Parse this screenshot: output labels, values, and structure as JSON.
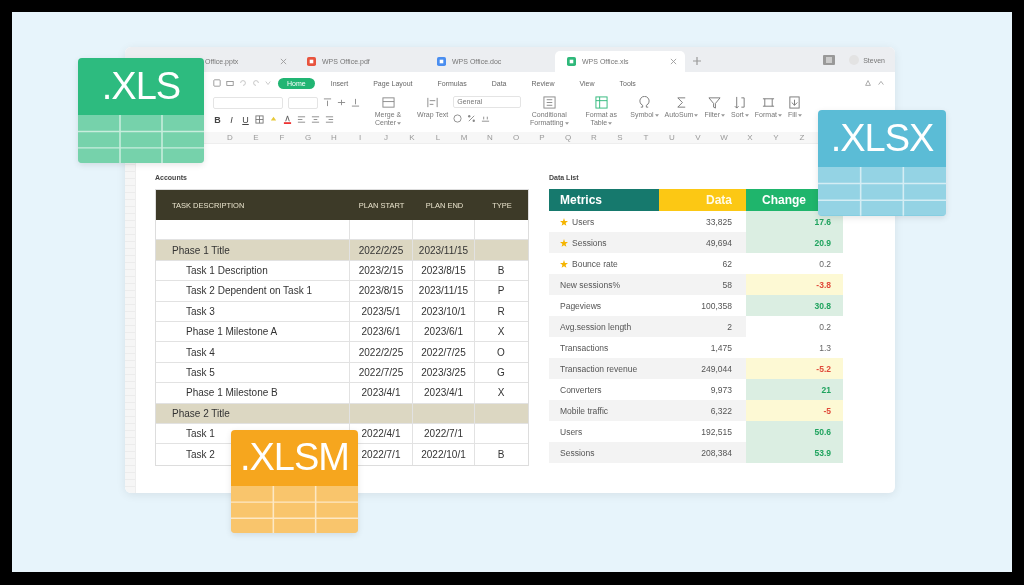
{
  "file_badges": [
    {
      "label": ".XLS",
      "color": "#2dbb7f"
    },
    {
      "label": ".XLSX",
      "color": "#5bbcd6"
    },
    {
      "label": ".XLSM",
      "color": "#f6a61e"
    }
  ],
  "tabs": [
    {
      "label": "Office.pptx",
      "selected": false,
      "closable": true
    },
    {
      "label": "WPS Office.pdf",
      "kind": "pdf",
      "selected": false,
      "closable": false
    },
    {
      "label": "WPS Office.doc",
      "kind": "doc",
      "selected": false,
      "closable": false
    },
    {
      "label": "WPS Office.xls",
      "kind": "xls",
      "selected": true,
      "closable": true
    }
  ],
  "user": {
    "name": "Steven"
  },
  "menu": [
    {
      "label": "Home",
      "selected": true
    },
    {
      "label": "Insert",
      "selected": false
    },
    {
      "label": "Page Layout",
      "selected": false
    },
    {
      "label": "Formulas",
      "selected": false
    },
    {
      "label": "Data",
      "selected": false
    },
    {
      "label": "Review",
      "selected": false
    },
    {
      "label": "View",
      "selected": false
    },
    {
      "label": "Tools",
      "selected": false
    }
  ],
  "format_buttons": [
    "B",
    "I",
    "U"
  ],
  "number_format": "General",
  "tools": [
    {
      "kind": "merge",
      "label": "Merge & Center",
      "dropdown": true
    },
    {
      "kind": "wrap",
      "label": "Wrap Text",
      "dropdown": false
    },
    {
      "kind": "conditional",
      "label": "Conditional Formatting",
      "dropdown": true
    },
    {
      "kind": "table",
      "label": "Format as Table",
      "dropdown": true
    },
    {
      "kind": "symbol",
      "label": "Symbol",
      "dropdown": true
    },
    {
      "kind": "sum",
      "label": "AutoSum",
      "dropdown": true
    },
    {
      "kind": "filter",
      "label": "Filter",
      "dropdown": true
    },
    {
      "kind": "sort",
      "label": "Sort",
      "dropdown": true
    },
    {
      "kind": "format",
      "label": "Format",
      "dropdown": true
    },
    {
      "kind": "fill",
      "label": "Fill",
      "dropdown": true
    }
  ],
  "column_letters": [
    "D",
    "E",
    "F",
    "G",
    "H",
    "I",
    "J",
    "K",
    "L",
    "M",
    "N",
    "O",
    "P",
    "Q",
    "R",
    "S",
    "T",
    "U",
    "V",
    "W",
    "X",
    "Y",
    "Z"
  ],
  "accounts": {
    "title": "Accounts",
    "columns": [
      "TASK DESCRIPTION",
      "PLAN START",
      "PLAN END",
      "TYPE"
    ],
    "rows": [
      {
        "kind": "blank"
      },
      {
        "kind": "phase",
        "task": "Phase 1 Title",
        "start": "2022/2/25",
        "end": "2023/11/15"
      },
      {
        "kind": "task",
        "task": "Task 1 Description",
        "start": "2023/2/15",
        "end": "2023/8/15",
        "type": "B"
      },
      {
        "kind": "task",
        "task": "Task 2 Dependent on Task 1",
        "start": "2023/8/15",
        "end": "2023/11/15",
        "type": "P"
      },
      {
        "kind": "task",
        "task": "Task 3",
        "start": "2023/5/1",
        "end": "2023/10/1",
        "type": "R"
      },
      {
        "kind": "task",
        "task": "Phase 1 Milestone A",
        "start": "2023/6/1",
        "end": "2023/6/1",
        "type": "X"
      },
      {
        "kind": "task",
        "task": "Task 4",
        "start": "2022/2/25",
        "end": "2022/7/25",
        "type": "O"
      },
      {
        "kind": "task",
        "task": "Task 5",
        "start": "2022/7/25",
        "end": "2023/3/25",
        "type": "G"
      },
      {
        "kind": "task",
        "task": "Phase 1 Milestone B",
        "start": "2023/4/1",
        "end": "2023/4/1",
        "type": "X"
      },
      {
        "kind": "phase",
        "task": "Phase 2 Title"
      },
      {
        "kind": "task",
        "task": "Task 1",
        "start": "2022/4/1",
        "end": "2022/7/1"
      },
      {
        "kind": "task",
        "task": "Task 2",
        "start": "2022/7/1",
        "end": "2022/10/1",
        "type": "B"
      }
    ]
  },
  "data_list": {
    "title": "Data List",
    "columns": [
      "Metrics",
      "Data",
      "Change"
    ],
    "rows": [
      {
        "metric": "Users",
        "starred": true,
        "data": "33,825",
        "change": "17.6",
        "kind": "up"
      },
      {
        "metric": "Sessions",
        "starred": true,
        "data": "49,694",
        "change": "20.9",
        "kind": "up"
      },
      {
        "metric": "Bounce rate",
        "starred": true,
        "data": "62",
        "change": "0.2",
        "kind": "flat"
      },
      {
        "metric": "New sessions%",
        "starred": false,
        "data": "58",
        "change": "-3.8",
        "kind": "down"
      },
      {
        "metric": "Pageviews",
        "starred": false,
        "data": "100,358",
        "change": "30.8",
        "kind": "up"
      },
      {
        "metric": "Avg.session length",
        "starred": false,
        "data": "2",
        "change": "0.2",
        "kind": "flat"
      },
      {
        "metric": "Transactions",
        "starred": false,
        "data": "1,475",
        "change": "1.3",
        "kind": "flat"
      },
      {
        "metric": "Transaction revenue",
        "starred": false,
        "data": "249,044",
        "change": "-5.2",
        "kind": "down"
      },
      {
        "metric": "Converters",
        "starred": false,
        "data": "9,973",
        "change": "21",
        "kind": "up"
      },
      {
        "metric": "Mobile traffic",
        "starred": false,
        "data": "6,322",
        "change": "-5",
        "kind": "down"
      },
      {
        "metric": "Users",
        "starred": false,
        "data": "192,515",
        "change": "50.6",
        "kind": "up"
      },
      {
        "metric": "Sessions",
        "starred": false,
        "data": "208,384",
        "change": "53.9",
        "kind": "up"
      }
    ]
  }
}
